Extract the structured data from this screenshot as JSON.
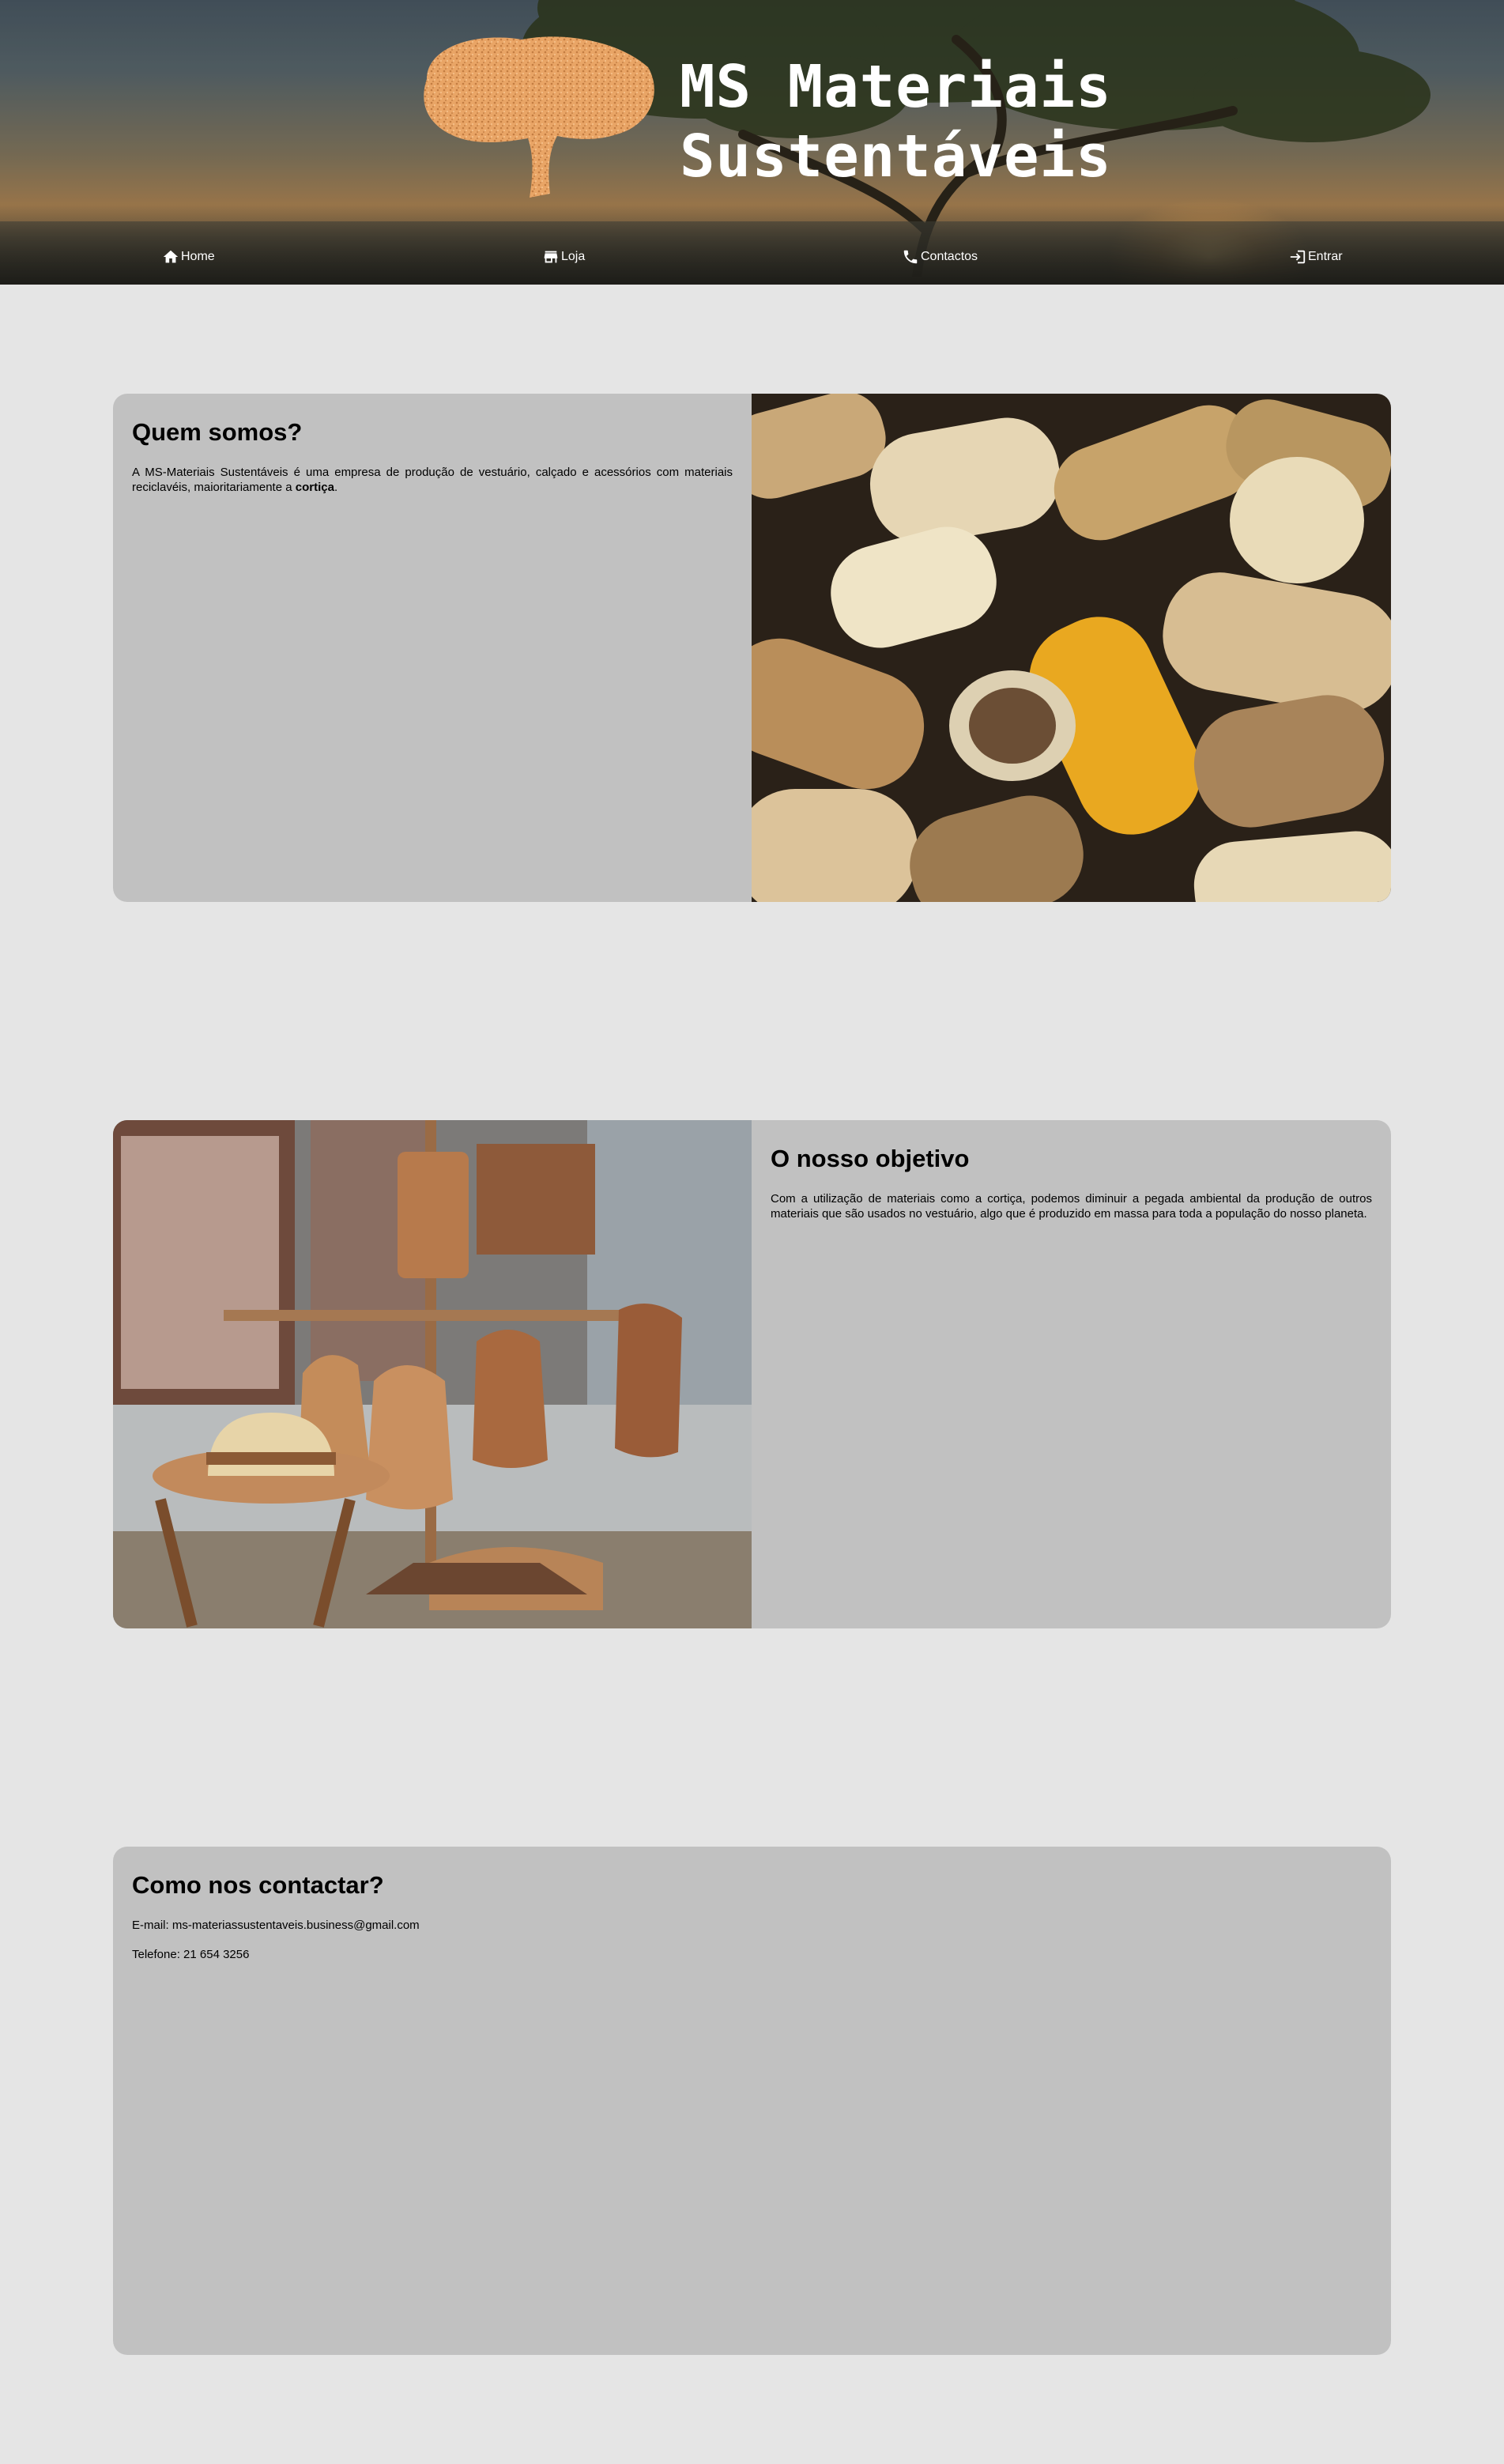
{
  "header": {
    "title_line1": "MS Materiais",
    "title_line2": "Sustentáveis",
    "logo": "cork-tree-logo"
  },
  "nav": {
    "items": [
      {
        "label": "Home",
        "icon": "home-icon"
      },
      {
        "label": "Loja",
        "icon": "store-icon"
      },
      {
        "label": "Contactos",
        "icon": "phone-icon"
      },
      {
        "label": "Entrar",
        "icon": "login-icon"
      }
    ]
  },
  "about": {
    "title": "Quem somos?",
    "text_before": "A MS-Materiais Sustentáveis é uma empresa de produção de vestuário, calçado e acessórios com materiais reciclavéis, maioritariamente a ",
    "text_bold": "cortiça",
    "text_after": ".",
    "image": "wine-corks-photo"
  },
  "goal": {
    "title": "O nosso objetivo",
    "text": "Com a utilização de materiais como a cortiça, podemos diminuir a pegada ambiental da produção de outros materiais que são usados no vestuário, algo que é produzido em massa para toda a população do nosso planeta.",
    "image": "cork-bags-hats-photo"
  },
  "contact": {
    "title": "Como nos contactar?",
    "email": "E-mail: ms-materiassustentaveis.business@gmail.com",
    "phone": "Telefone: 21 654 3256"
  },
  "colors": {
    "page_bg": "#e5e5e5",
    "card_bg": "#c1c1c1",
    "nav_text": "#ffffff"
  }
}
